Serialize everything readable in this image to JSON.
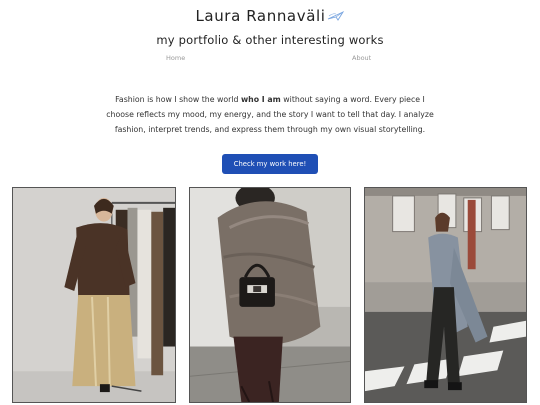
{
  "header": {
    "title": "Laura Rannaväli",
    "subtitle": "my portfolio & other interesting works"
  },
  "nav": {
    "items": [
      {
        "label": "Home"
      },
      {
        "label": "About"
      }
    ]
  },
  "intro": {
    "part1": "Fashion is how I show the world ",
    "emphasis": "who I am",
    "part2": " without saying a word. Every piece I choose reflects my mood, my energy, and the story I want to tell that day. I analyze fashion, interpret trends, and express them through my own visual storytelling."
  },
  "cta": {
    "label": "Check my work here!"
  },
  "gallery": {
    "images": [
      {
        "icon": "photo-brown-jacket-satin-skirt"
      },
      {
        "icon": "photo-grey-fur-coat-handbag"
      },
      {
        "icon": "photo-grey-coat-street-crossing"
      }
    ]
  },
  "colors": {
    "accent": "#1f4fb5",
    "nav_text": "#999999",
    "logo": "#7aa6e0"
  }
}
